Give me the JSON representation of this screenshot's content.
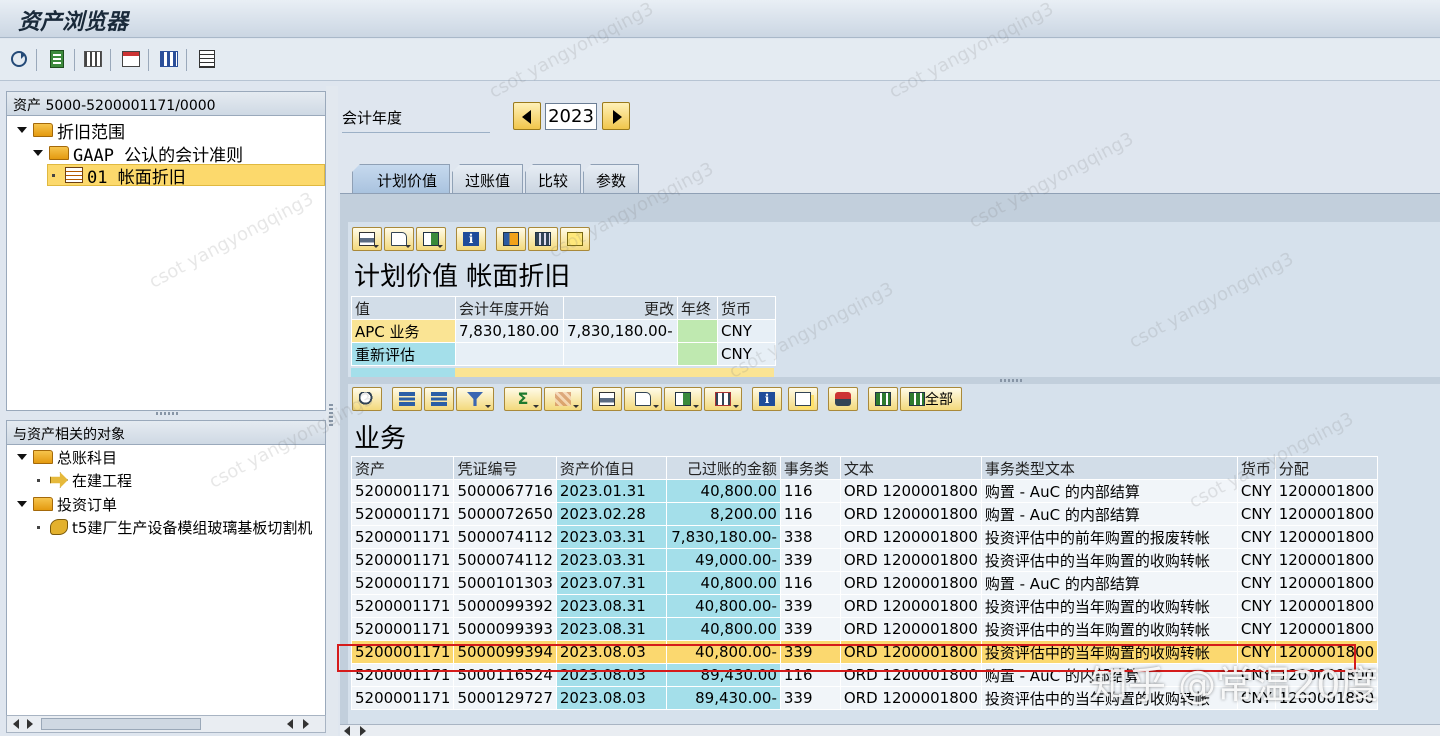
{
  "window": {
    "title": "资产浏览器"
  },
  "toolbar": {
    "icons": [
      "refresh-icon",
      "display-icon",
      "asset-values-icon",
      "structure-icon",
      "overview-icon",
      "list-icon"
    ]
  },
  "tree": {
    "header": "资产 5000-5200001171/0000",
    "nodes": [
      {
        "label": "折旧范围"
      },
      {
        "label": "GAAP 公认的会计准则"
      },
      {
        "label": "01 帐面折旧"
      }
    ]
  },
  "related": {
    "header": "与资产相关的对象",
    "nodes": [
      {
        "label": "总账科目"
      },
      {
        "label": "在建工程"
      },
      {
        "label": "投资订单"
      },
      {
        "label": "t5建厂生产设备模组玻璃基板切割机"
      }
    ]
  },
  "fiscal": {
    "label": "会计年度",
    "year": "2023"
  },
  "tabs": [
    {
      "label": "计划价值"
    },
    {
      "label": "过账值"
    },
    {
      "label": "比较"
    },
    {
      "label": "参数"
    }
  ],
  "planned": {
    "title": "计划价值 帐面折旧",
    "headers": [
      "值",
      "会计年度开始",
      "更改",
      "年终",
      "货币"
    ],
    "rows": [
      {
        "value": "APC 业务",
        "start": "7,830,180.00",
        "change": "7,830,180.00-",
        "year_end": "",
        "currency": "CNY"
      },
      {
        "value": "重新评估",
        "start": "",
        "change": "",
        "year_end": "",
        "currency": "CNY"
      }
    ]
  },
  "transactions": {
    "title": "业务",
    "all_button": "全部",
    "headers": [
      "资产",
      "凭证编号",
      "资产价值日",
      "己过账的金额",
      "事务类",
      "文本",
      "事务类型文本",
      "货币",
      "分配"
    ],
    "rows": [
      [
        "5200001171",
        "5000067716",
        "2023.01.31",
        "40,800.00",
        "116",
        "ORD 1200001800",
        "购置 - AuC 的内部结算",
        "CNY",
        "1200001800"
      ],
      [
        "5200001171",
        "5000072650",
        "2023.02.28",
        "8,200.00",
        "116",
        "ORD 1200001800",
        "购置 - AuC 的内部结算",
        "CNY",
        "1200001800"
      ],
      [
        "5200001171",
        "5000074112",
        "2023.03.31",
        "7,830,180.00-",
        "338",
        "ORD 1200001800",
        "投资评估中的前年购置的报废转帐",
        "CNY",
        "1200001800"
      ],
      [
        "5200001171",
        "5000074112",
        "2023.03.31",
        "49,000.00-",
        "339",
        "ORD 1200001800",
        "投资评估中的当年购置的收购转帐",
        "CNY",
        "1200001800"
      ],
      [
        "5200001171",
        "5000101303",
        "2023.07.31",
        "40,800.00",
        "116",
        "ORD 1200001800",
        "购置 - AuC 的内部结算",
        "CNY",
        "1200001800"
      ],
      [
        "5200001171",
        "5000099392",
        "2023.08.31",
        "40,800.00-",
        "339",
        "ORD 1200001800",
        "投资评估中的当年购置的收购转帐",
        "CNY",
        "1200001800"
      ],
      [
        "5200001171",
        "5000099393",
        "2023.08.31",
        "40,800.00",
        "339",
        "ORD 1200001800",
        "投资评估中的当年购置的收购转帐",
        "CNY",
        "1200001800"
      ],
      [
        "5200001171",
        "5000099394",
        "2023.08.03",
        "40,800.00-",
        "339",
        "ORD 1200001800",
        "投资评估中的当年购置的收购转帐",
        "CNY",
        "1200001800"
      ],
      [
        "5200001171",
        "5000116524",
        "2023.08.03",
        "89,430.00",
        "116",
        "ORD 1200001800",
        "购置 - AuC 的内部结算",
        "CNY",
        "1200001800"
      ],
      [
        "5200001171",
        "5000129727",
        "2023.08.03",
        "89,430.00-",
        "339",
        "ORD 1200001800",
        "投资评估中的当年购置的收购转帐",
        "CNY",
        "1200001800"
      ]
    ],
    "highlighted_row": 7
  },
  "watermark": {
    "text": "csot yangyongqing3",
    "brand": "知乎 @常温20度"
  }
}
